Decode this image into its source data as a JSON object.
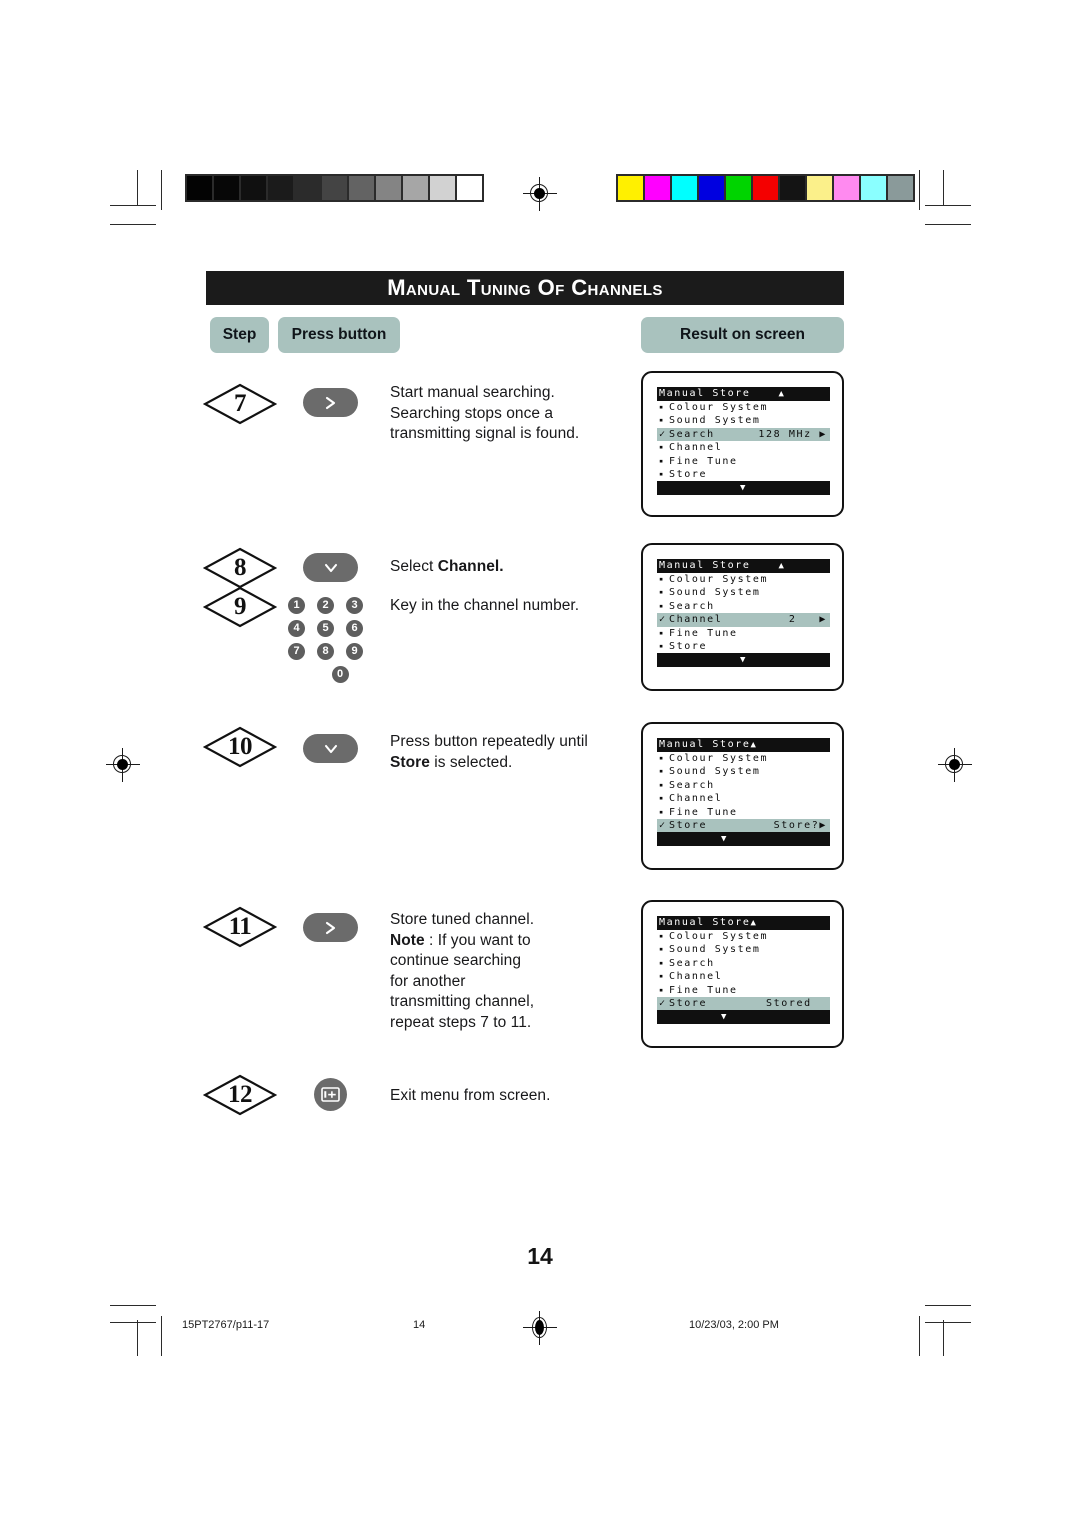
{
  "page": {
    "title": "Manual Tuning of Channels",
    "page_number": "14"
  },
  "columns": {
    "step": "Step",
    "press_button": "Press button",
    "result": "Result on screen"
  },
  "steps": [
    {
      "number": "7",
      "button_icon": "chevron-right-icon",
      "instruction_html": "Start manual searching. Searching stops once a transmitting signal is found.",
      "instruction_text": "Start manual searching. Searching stops once a transmitting signal is found."
    },
    {
      "number": "8",
      "button_icon": "chevron-down-icon",
      "instruction_text": "Select Channel.",
      "instruction_prefix": "Select ",
      "instruction_bold": "Channel.",
      "instruction_suffix": ""
    },
    {
      "number": "9",
      "button_icon": "numeric-keypad-icon",
      "instruction_text": "Key in the channel number."
    },
    {
      "number": "10",
      "button_icon": "chevron-down-icon",
      "instruction_prefix": "Press button repeatedly until ",
      "instruction_bold": "Store",
      "instruction_suffix": " is selected.",
      "instruction_text": "Press button repeatedly until Store is selected."
    },
    {
      "number": "11",
      "button_icon": "chevron-right-icon",
      "instruction_line1": "Store tuned  channel.",
      "instruction_bold": "Note",
      "instruction_suffix": " : If you want to continue searching for another transmitting channel, repeat steps 7 to 11.",
      "instruction_text": "Store tuned  channel. Note : If you want to continue searching for another transmitting channel, repeat steps 7 to 11."
    },
    {
      "number": "12",
      "button_icon": "menu-exit-icon",
      "instruction_text": "Exit menu from screen."
    }
  ],
  "keypad": {
    "rows": [
      [
        "1",
        "2",
        "3"
      ],
      [
        "4",
        "5",
        "6"
      ],
      [
        "7",
        "8",
        "9"
      ]
    ],
    "zero": "0"
  },
  "osd_panels": [
    {
      "title": "Manual Store",
      "title_arrow": "▲",
      "title_arrow_spaced": true,
      "foot_arrow": "▼",
      "foot_arrow_centered": true,
      "rows": [
        {
          "label": "Colour System",
          "marker": "▪",
          "value": "",
          "highlight": false
        },
        {
          "label": "Sound System",
          "marker": "▪",
          "value": "",
          "highlight": false
        },
        {
          "label": "Search",
          "marker": "✓",
          "value": "128 MHz ▶",
          "highlight": true
        },
        {
          "label": "Channel",
          "marker": "▪",
          "value": "",
          "highlight": false
        },
        {
          "label": "Fine Tune",
          "marker": "▪",
          "value": "",
          "highlight": false
        },
        {
          "label": "Store",
          "marker": "▪",
          "value": "",
          "highlight": false
        }
      ]
    },
    {
      "title": "Manual Store",
      "title_arrow": "▲",
      "title_arrow_spaced": true,
      "foot_arrow": "▼",
      "foot_arrow_centered": true,
      "rows": [
        {
          "label": "Colour System",
          "marker": "▪",
          "value": "",
          "highlight": false
        },
        {
          "label": "Sound System",
          "marker": "▪",
          "value": "",
          "highlight": false
        },
        {
          "label": "Search",
          "marker": "▪",
          "value": "",
          "highlight": false
        },
        {
          "label": "Channel",
          "marker": "✓",
          "value": "2   ▶",
          "highlight": true
        },
        {
          "label": "Fine Tune",
          "marker": "▪",
          "value": "",
          "highlight": false
        },
        {
          "label": "Store",
          "marker": "▪",
          "value": "",
          "highlight": false
        }
      ]
    },
    {
      "title": "Manual Store",
      "title_arrow": "▲",
      "title_arrow_spaced": false,
      "foot_arrow": "▼",
      "foot_arrow_centered": false,
      "rows": [
        {
          "label": "Colour System",
          "marker": "▪",
          "value": "",
          "highlight": false
        },
        {
          "label": "Sound System",
          "marker": "▪",
          "value": "",
          "highlight": false
        },
        {
          "label": "Search",
          "marker": "▪",
          "value": "",
          "highlight": false
        },
        {
          "label": "Channel",
          "marker": "▪",
          "value": "",
          "highlight": false
        },
        {
          "label": "Fine Tune",
          "marker": "▪",
          "value": "",
          "highlight": false
        },
        {
          "label": "Store",
          "marker": "✓",
          "value": "Store?▶",
          "highlight": true
        }
      ]
    },
    {
      "title": "Manual Store",
      "title_arrow": "▲",
      "title_arrow_spaced": false,
      "foot_arrow": "▼",
      "foot_arrow_centered": false,
      "rows": [
        {
          "label": "Colour System",
          "marker": "▪",
          "value": "",
          "highlight": false
        },
        {
          "label": "Sound System",
          "marker": "▪",
          "value": "",
          "highlight": false
        },
        {
          "label": "Search",
          "marker": "▪",
          "value": "",
          "highlight": false
        },
        {
          "label": "Channel",
          "marker": "▪",
          "value": "",
          "highlight": false
        },
        {
          "label": "Fine Tune",
          "marker": "▪",
          "value": "",
          "highlight": false
        },
        {
          "label": "Store",
          "marker": "✓",
          "value": "Stored  ",
          "highlight": true
        }
      ]
    }
  ],
  "print_marks": {
    "grayscale_patches": [
      "#030303",
      "#070707",
      "#101010",
      "#1b1b1b",
      "#2b2b2b",
      "#444444",
      "#636363",
      "#848484",
      "#a6a6a6",
      "#d2d2d2",
      "#ffffff"
    ],
    "color_patches": [
      "#fff000",
      "#ff00ff",
      "#00ffff",
      "#0000e0",
      "#00d400",
      "#f40000",
      "#141414",
      "#fbf08a",
      "#ff8af0",
      "#8affff",
      "#8a9a9a"
    ]
  },
  "footer": {
    "file": "15PT2767/p11-17",
    "page": "14",
    "timestamp": "10/23/03, 2:00 PM"
  }
}
